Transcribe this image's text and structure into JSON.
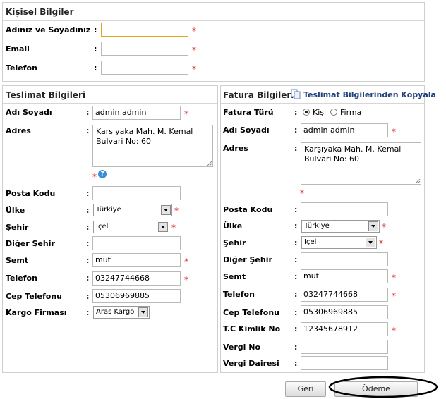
{
  "personal": {
    "title": "Kişisel Bilgiler",
    "name_label": "Adınız ve Soyadınız",
    "email_label": "Email",
    "phone_label": "Telefon",
    "name_value": "",
    "email_value": "",
    "phone_value": ""
  },
  "colon": ":",
  "required_mark": "*",
  "shipping": {
    "title": "Teslimat Bilgileri",
    "fields": {
      "name_label": "Adı Soyadı",
      "name_value": "admin admin",
      "address_label": "Adres",
      "address_value": "Karşıyaka Mah. M. Kemal\nBulvari No: 60",
      "postal_label": "Posta Kodu",
      "postal_value": "",
      "country_label": "Ülke",
      "country_value": "Türkiye",
      "city_label": "Şehir",
      "city_value": "İçel",
      "other_city_label": "Diğer Şehir",
      "other_city_value": "",
      "district_label": "Semt",
      "district_value": "mut",
      "phone_label": "Telefon",
      "phone_value": "03247744668",
      "mobile_label": "Cep Telefonu",
      "mobile_value": "05306969885",
      "cargo_label": "Kargo Firması",
      "cargo_value": "Aras Kargo"
    }
  },
  "billing": {
    "title": "Fatura Bilgileri",
    "copy_link": "Teslimat Bilgilerinden Kopyala",
    "fields": {
      "type_label": "Fatura Türü",
      "type_person": "Kişi",
      "type_company": "Firma",
      "type_selected": "Kişi",
      "name_label": "Adı Soyadı",
      "name_value": "admin admin",
      "address_label": "Adres",
      "address_value": "Karşıyaka Mah. M. Kemal\nBulvari No: 60",
      "postal_label": "Posta Kodu",
      "postal_value": "",
      "country_label": "Ülke",
      "country_value": "Türkiye",
      "city_label": "Şehir",
      "city_value": "İçel",
      "other_city_label": "Diğer Şehir",
      "other_city_value": "",
      "district_label": "Semt",
      "district_value": "mut",
      "phone_label": "Telefon",
      "phone_value": "03247744668",
      "mobile_label": "Cep Telefonu",
      "mobile_value": "05306969885",
      "tc_label": "T.C Kimlik No",
      "tc_value": "12345678912",
      "tax_no_label": "Vergi No",
      "tax_no_value": "",
      "tax_office_label": "Vergi Dairesi",
      "tax_office_value": ""
    }
  },
  "buttons": {
    "back": "Geri",
    "payment": "Ödeme"
  },
  "icons": {
    "help": "help-icon",
    "copy": "copy-icon",
    "dropdown": "chevron-down-icon"
  },
  "colors": {
    "required": "#e02020",
    "focus_border": "#e6a320",
    "link": "#1f3f7a",
    "help": "#3b8fd4",
    "highlight_ellipse": "#000000"
  }
}
